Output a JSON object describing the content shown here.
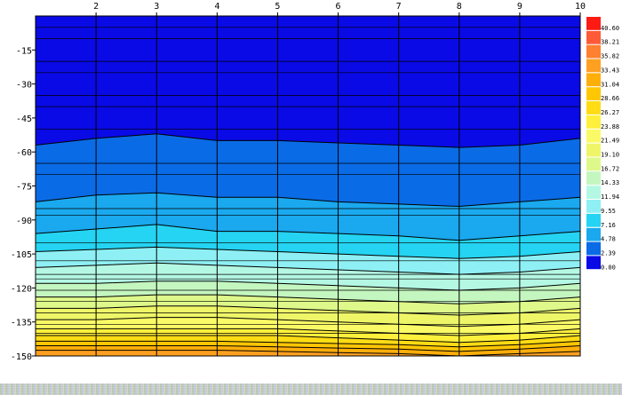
{
  "chart_data": {
    "type": "heatmap",
    "x": {
      "min": 1,
      "max": 10,
      "ticks": [
        2,
        3,
        4,
        5,
        6,
        7,
        8,
        9,
        10
      ],
      "tick_labels": [
        "2",
        "3",
        "4",
        "5",
        "6",
        "7",
        "8",
        "9",
        "10"
      ],
      "position": "top"
    },
    "y": {
      "min": -150,
      "max": 0,
      "ticks": [
        -15,
        -30,
        -45,
        -60,
        -75,
        -90,
        -105,
        -120,
        -135,
        -150
      ],
      "tick_labels": [
        "-15",
        "-30",
        "-45",
        "-60",
        "-75",
        "-90",
        "-105",
        "-120",
        "-135",
        "-150"
      ]
    },
    "grid": true,
    "legend_placement": "right",
    "levels": [
      "0.00",
      "2.39",
      "4.78",
      "7.16",
      "9.55",
      "11.94",
      "14.33",
      "16.72",
      "19.10",
      "21.49",
      "23.88",
      "26.27",
      "28.66",
      "31.04",
      "33.43",
      "35.82",
      "38.21",
      "40.60"
    ],
    "level_values": [
      0.0,
      2.39,
      4.78,
      7.16,
      9.55,
      11.94,
      14.33,
      16.72,
      19.1,
      21.49,
      23.88,
      26.27,
      28.66,
      31.04,
      33.43,
      35.82,
      38.21,
      40.6
    ],
    "colors": [
      "#0a0ae6",
      "#0a6be6",
      "#1aa8ee",
      "#24d4f2",
      "#8ef0f4",
      "#b4f8e4",
      "#c4f6c0",
      "#def88a",
      "#eef668",
      "#fafa66",
      "#fff03c",
      "#ffdc14",
      "#ffc604",
      "#ffae0a",
      "#ffa020",
      "#ff8030",
      "#ff5a38",
      "#ff1a14"
    ],
    "boundaries_depth": [
      {
        "level": "2.39",
        "depth": [
          -57,
          -54,
          -52,
          -55,
          -55,
          -56,
          -57,
          -58,
          -57,
          -54
        ]
      },
      {
        "level": "4.78",
        "depth": [
          -82,
          -79,
          -78,
          -80,
          -80,
          -82,
          -83,
          -84,
          -82,
          -80
        ]
      },
      {
        "level": "7.16",
        "depth": [
          -96,
          -94,
          -92,
          -95,
          -95,
          -96,
          -97,
          -99,
          -97,
          -95
        ]
      },
      {
        "level": "9.55",
        "depth": [
          -104,
          -103,
          -102,
          -103,
          -104,
          -105,
          -106,
          -107,
          -106,
          -104
        ]
      },
      {
        "level": "11.94",
        "depth": [
          -111,
          -110,
          -109,
          -110,
          -111,
          -112,
          -113,
          -114,
          -113,
          -111
        ]
      },
      {
        "level": "14.33",
        "depth": [
          -118,
          -118,
          -117,
          -117,
          -118,
          -119,
          -120,
          -121,
          -120,
          -118
        ]
      },
      {
        "level": "16.72",
        "depth": [
          -124,
          -124,
          -123,
          -123,
          -124,
          -125,
          -126,
          -127,
          -126,
          -124
        ]
      },
      {
        "level": "19.10",
        "depth": [
          -129,
          -129,
          -128,
          -128,
          -129,
          -130,
          -131,
          -132,
          -131,
          -129
        ]
      },
      {
        "level": "21.49",
        "depth": [
          -134,
          -134,
          -133,
          -133,
          -134,
          -135,
          -136,
          -137,
          -136,
          -134
        ]
      },
      {
        "level": "23.88",
        "depth": [
          -138,
          -138,
          -138,
          -138,
          -138,
          -139,
          -140,
          -141,
          -140,
          -138
        ]
      },
      {
        "level": "26.27",
        "depth": [
          -141,
          -141,
          -141,
          -141,
          -141,
          -142,
          -143,
          -144,
          -143,
          -141
        ]
      },
      {
        "level": "28.66",
        "depth": [
          -143.5,
          -143.5,
          -143.5,
          -143.5,
          -144,
          -144.5,
          -145,
          -146,
          -145,
          -143.5
        ]
      },
      {
        "level": "31.04",
        "depth": [
          -145.5,
          -145.5,
          -145.5,
          -145.5,
          -146,
          -146.5,
          -147,
          -148,
          -147,
          -145.5
        ]
      },
      {
        "level": "33.43",
        "depth": [
          -147.5,
          -147.5,
          -147.5,
          -147.5,
          -148,
          -148.5,
          -149,
          -150,
          -149,
          -148
        ]
      }
    ],
    "line_contours_depth": [
      -5,
      -10,
      -20,
      -25,
      -35,
      -40,
      -50,
      -65,
      -70,
      -85,
      -88,
      -100,
      -108,
      -114,
      -116,
      -121,
      -126,
      -131,
      -136,
      -140
    ]
  }
}
